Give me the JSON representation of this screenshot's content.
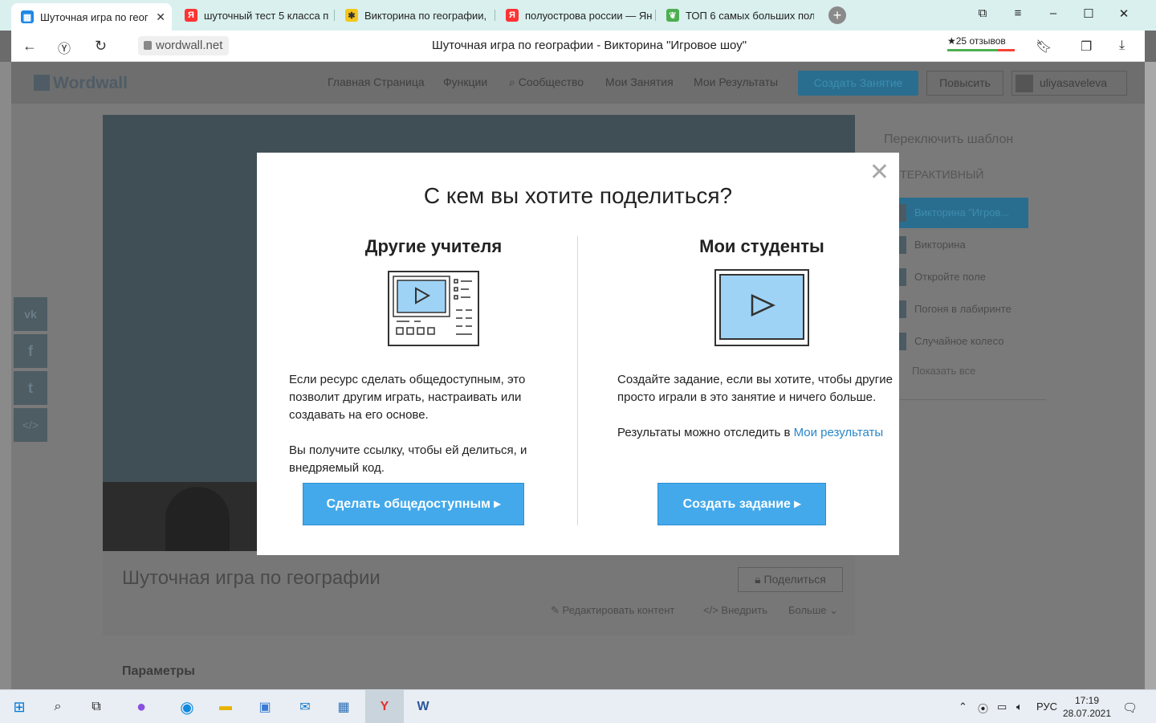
{
  "browser": {
    "tabs": [
      {
        "title": "Шуточная игра по геог",
        "icon": "wordwall-favicon",
        "active": true
      },
      {
        "title": "шуточный тест 5 класса п",
        "icon": "yandex-favicon"
      },
      {
        "title": "Викторина по географии,",
        "icon": "quiz-favicon"
      },
      {
        "title": "полуострова россии — Ян",
        "icon": "yandex-favicon"
      },
      {
        "title": "ТОП 6 самых больших пол",
        "icon": "leaf-favicon"
      }
    ],
    "url": "wordwall.net",
    "page_title": "Шуточная игра по географии - Викторина \"Игровое шоу\"",
    "reviews": "★25 отзывов"
  },
  "site": {
    "logo": "Wordwall",
    "nav": [
      "Главная Страница",
      "Функции",
      "Сообщество",
      "Мои Занятия",
      "Мои Результаты"
    ],
    "create_button": "Создать Занятие",
    "upgrade_button": "Повысить",
    "username": "uliyasaveleva",
    "game_title": "Шуточная игра по географии",
    "share_button": "Поделиться",
    "edit_link": "Редактировать контент",
    "embed_link": "Внедрить",
    "more_link": "Больше",
    "params_heading": "Параметры",
    "social": [
      "vk",
      "f",
      "t",
      "</>"
    ],
    "templates": {
      "heading": "Переключить шаблон",
      "subheading": "ИНТЕРАКТИВНЫЙ",
      "items": [
        "Викторина \"Игров...",
        "Викторина",
        "Откройте поле",
        "Погоня в лабиринте",
        "Случайное колесо"
      ],
      "show_all": "Показать все"
    }
  },
  "modal": {
    "title": "С кем вы хотите поделиться?",
    "left": {
      "heading": "Другие учителя",
      "p1": "Если ресурс сделать общедоступным, это позволит другим играть, настраивать или создавать на его основе.",
      "p2": "Вы получите ссылку, чтобы ей делиться, и внедряемый код.",
      "button": "Сделать общедоступным ▸"
    },
    "right": {
      "heading": "Мои студенты",
      "p1": "Создайте задание, если вы хотите, чтобы другие просто играли в это занятие и ничего больше.",
      "p2_prefix": "Результаты можно отследить в ",
      "p2_link": "Мои результаты",
      "button": "Создать задание ▸"
    }
  },
  "taskbar": {
    "lang": "РУС",
    "time": "17:19",
    "date": "28.07.2021"
  },
  "colors": {
    "accent": "#43a9eb",
    "link": "#2a86c7",
    "tabbar": "#d9f0ee"
  }
}
